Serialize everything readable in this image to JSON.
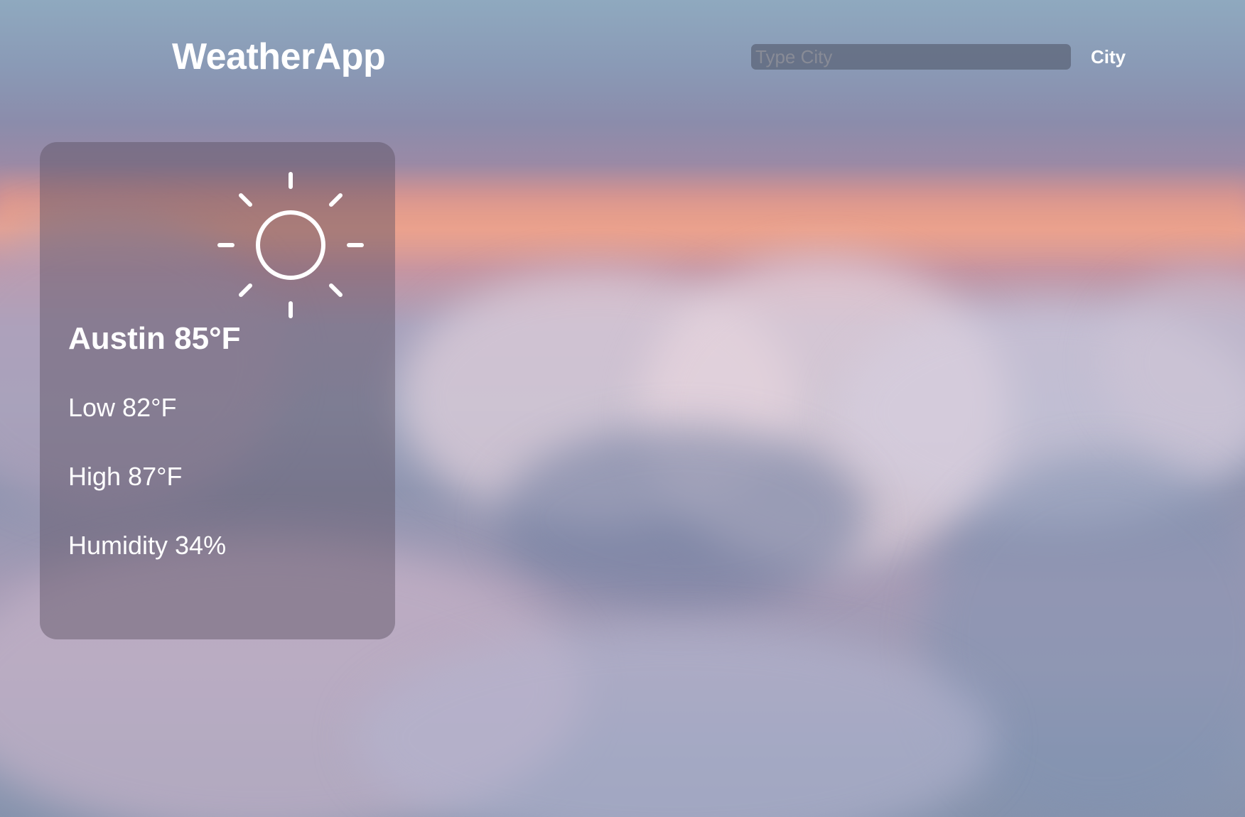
{
  "header": {
    "brand": "WeatherApp",
    "search_placeholder": "Type City",
    "search_value": "",
    "city_button_label": "City"
  },
  "weather": {
    "icon": "sun-icon",
    "title": "Austin 85°F",
    "low": "Low 82°F",
    "high": "High 87°F",
    "humidity": "Humidity 34%"
  },
  "colors": {
    "text": "#ffffff",
    "card_background": "#5c5062",
    "input_background": "#5a6276"
  }
}
